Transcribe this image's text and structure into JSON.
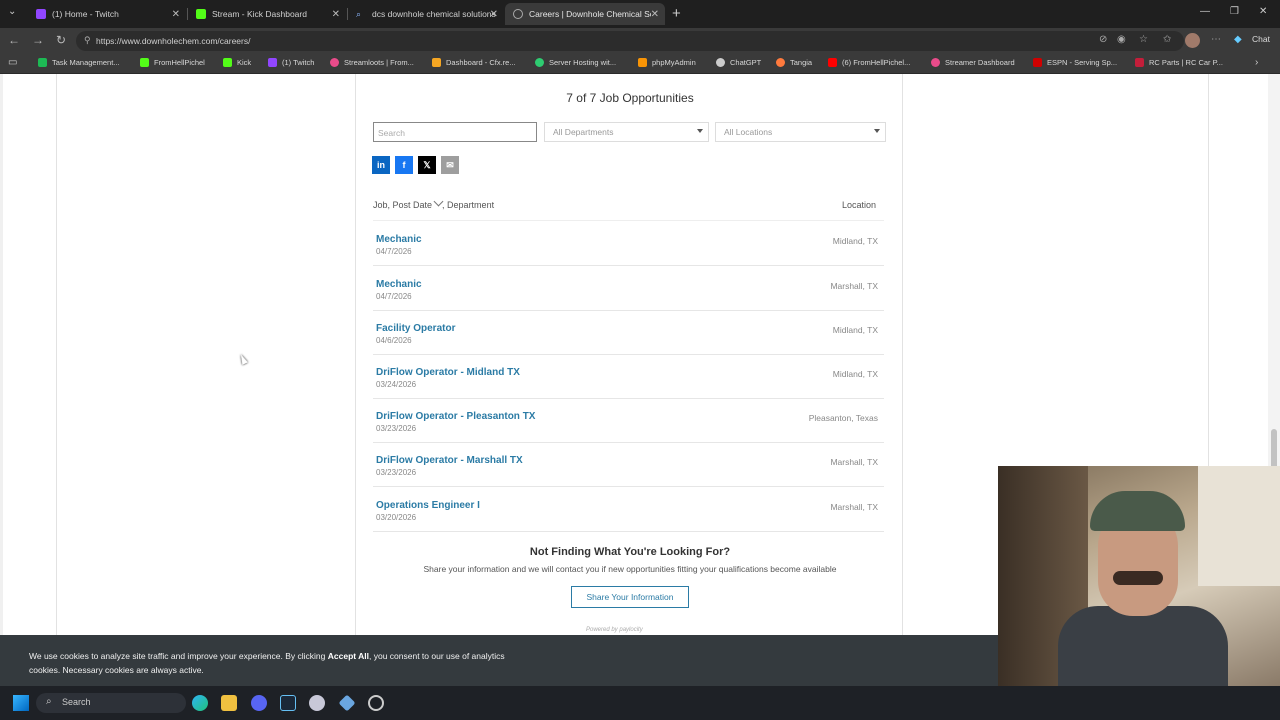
{
  "browser": {
    "tabs": [
      {
        "label": "(1) Home - Twitch",
        "icon_color": "#9146ff"
      },
      {
        "label": "Stream - Kick Dashboard",
        "icon_color": "#53fc18"
      },
      {
        "label": "dcs downhole chemical solutions",
        "icon_color": "#4285f4"
      },
      {
        "label": "Careers | Downhole Chemical Solu",
        "icon_color": "#9aa0a6"
      }
    ],
    "url": "https://www.downholechem.com/careers/",
    "bookmarks": [
      {
        "label": "Task Management...",
        "color": "#1db954"
      },
      {
        "label": "FromHellPichel",
        "color": "#53fc18"
      },
      {
        "label": "Kick",
        "color": "#53fc18"
      },
      {
        "label": "(1) Twitch",
        "color": "#9146ff"
      },
      {
        "label": "Streamloots | From...",
        "color": "#e94b8a"
      },
      {
        "label": "Dashboard - Cfx.re...",
        "color": "#f5a623"
      },
      {
        "label": "Server Hosting wit...",
        "color": "#2ecc71"
      },
      {
        "label": "phpMyAdmin",
        "color": "#f89406"
      },
      {
        "label": "ChatGPT",
        "color": "#cccccc"
      },
      {
        "label": "Tangia",
        "color": "#ff7a3d"
      },
      {
        "label": "(6) FromHellPichel...",
        "color": "#ff0000"
      },
      {
        "label": "Streamer Dashboard",
        "color": "#e94b8a"
      },
      {
        "label": "ESPN - Serving Sp...",
        "color": "#d00000"
      },
      {
        "label": "RC Parts | RC Car P...",
        "color": "#c41e3a"
      }
    ],
    "chat_label": "Chat"
  },
  "careers": {
    "heading": "7 of 7 Job Opportunities",
    "search_placeholder": "Search",
    "departments_label": "All Departments",
    "locations_label": "All Locations",
    "col_job": "Job, Post Date",
    "col_department": ", Department",
    "col_location": "Location",
    "jobs": [
      {
        "title": "Mechanic",
        "date": "04/7/2026",
        "location": "Midland, TX"
      },
      {
        "title": "Mechanic",
        "date": "04/7/2026",
        "location": "Marshall, TX"
      },
      {
        "title": "Facility Operator",
        "date": "04/6/2026",
        "location": "Midland, TX"
      },
      {
        "title": "DriFlow Operator - Midland TX",
        "date": "03/24/2026",
        "location": "Midland, TX"
      },
      {
        "title": "DriFlow Operator - Pleasanton TX",
        "date": "03/23/2026",
        "location": "Pleasanton, Texas"
      },
      {
        "title": "DriFlow Operator - Marshall TX",
        "date": "03/23/2026",
        "location": "Marshall, TX"
      },
      {
        "title": "Operations Engineer I",
        "date": "03/20/2026",
        "location": "Marshall, TX"
      }
    ],
    "not_finding_title": "Not Finding What You're Looking For?",
    "not_finding_text": "Share your information and we will contact you if new opportunities fitting your qualifications become available",
    "share_button": "Share Your Information",
    "powered_by": "Powered by paylocity"
  },
  "cookie": {
    "text_before": "We use cookies to analyze site traffic and improve your experience. By clicking ",
    "accept": "Accept All",
    "text_after": ", you consent to our use of analytics cookies. Necessary cookies are always active."
  },
  "taskbar": {
    "search_label": "Search"
  },
  "colors": {
    "link": "#2b7ba5",
    "linkedin": "#0a66c2",
    "facebook": "#1877f2",
    "x": "#000000",
    "email": "#9e9e9e"
  }
}
